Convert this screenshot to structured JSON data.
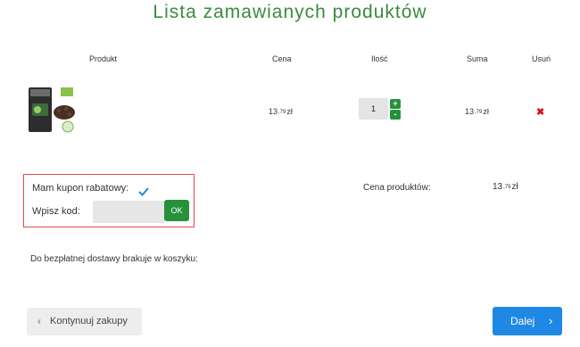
{
  "page_title": "Lista zamawianych produktów",
  "table": {
    "headers": {
      "product": "Produkt",
      "price": "Cena",
      "quantity": "Ilość",
      "sum": "Suma",
      "remove": "Usuń"
    },
    "rows": [
      {
        "price_int": "13",
        "price_dec": ",79",
        "price_unit": "zł",
        "quantity": "1",
        "sum_int": "13",
        "sum_dec": ",79",
        "sum_unit": "zł",
        "plus": "+",
        "minus": "-",
        "remove_symbol": "✖"
      }
    ]
  },
  "coupon": {
    "have_coupon_label": "Mam kupon rabatowy:",
    "checked": true,
    "code_label": "Wpisz kod:",
    "code_value": "",
    "ok_label": "OK"
  },
  "summary": {
    "products_price_label": "Cena produktów:",
    "products_price_int": "13",
    "products_price_dec": ",79",
    "products_price_unit": "zł"
  },
  "free_delivery_text": "Do bezpłatnej dostawy brakuje w koszyku:",
  "buttons": {
    "continue_label": "Kontynuuj zakupy",
    "continue_icon": "‹",
    "next_label": "Dalej",
    "next_icon": "›"
  },
  "colors": {
    "accent_green": "#27913a",
    "title_green": "#3b8a3f",
    "primary_blue": "#1f88e5",
    "remove_red": "#dd1111",
    "coupon_border": "#e04a55"
  }
}
